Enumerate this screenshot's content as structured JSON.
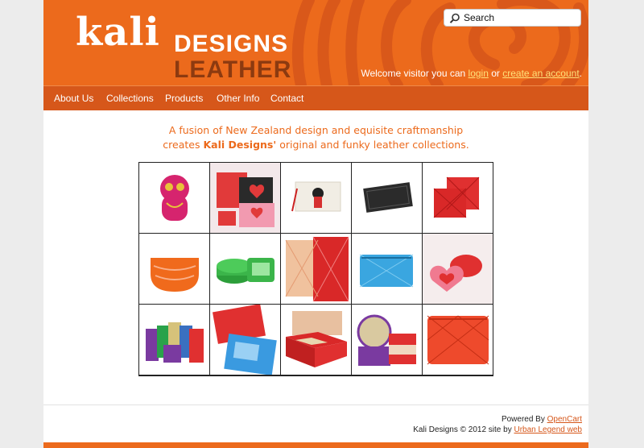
{
  "header": {
    "logo_kali": "kali",
    "logo_designs": "DESIGNS",
    "logo_leather": "LEATHER",
    "search_placeholder": "Search",
    "welcome": {
      "prefix": "Welcome visitor you can",
      "login": "login",
      "middle": "or",
      "create_account": "create an account",
      "suffix": "."
    }
  },
  "nav": {
    "items": [
      "About Us",
      "Collections",
      "Products",
      "Other Info",
      "Contact"
    ]
  },
  "tagline": {
    "line1": "A fusion of New Zealand design and equisite craftmanship",
    "line2_prefix": "creates",
    "brand": "Kali Designs'",
    "line2_suffix": "original and funky leather collections."
  },
  "products": [
    "pink tiki pouch",
    "red heart purses",
    "doll print clutch",
    "black woven wallet",
    "red quilted cardholders",
    "orange coin purse",
    "green jewellery case",
    "red and tan notebooks",
    "blue coin purse",
    "heart box",
    "colourful wallets",
    "red and blue luggage tags",
    "red jewellery box",
    "round jewellery cases",
    "red quilted pouch"
  ],
  "footer": {
    "powered_by": "Powered By",
    "opencart": "OpenCart",
    "copyright": "Kali Designs © 2012 site by",
    "site_by": "Urban Legend web"
  },
  "colors": {
    "brand_orange": "#ec6a1c",
    "nav_orange": "#d6571a",
    "logo_brown": "#8c3a10",
    "link_yellow": "#ffe17a"
  }
}
